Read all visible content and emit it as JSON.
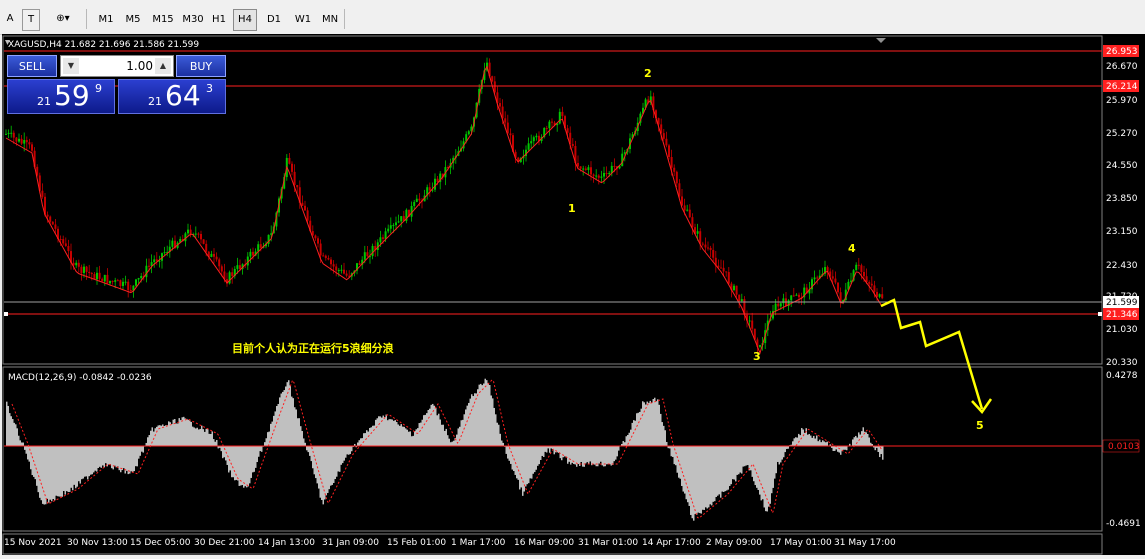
{
  "toolbar": {
    "tools": [
      {
        "name": "text-label-tool",
        "glyph": "A"
      },
      {
        "name": "text-tool",
        "glyph": "T"
      },
      {
        "name": "objects-tool",
        "glyph": "⊕▾"
      }
    ],
    "timeframes": [
      "M1",
      "M5",
      "M15",
      "M30",
      "H1",
      "H4",
      "D1",
      "W1",
      "MN"
    ],
    "active_timeframe": "H4"
  },
  "chart": {
    "header": "XAGUSD,H4  21.682 21.696 21.586 21.599",
    "macd_label": "MACD(12,26,9) -0.0842 -0.0236",
    "annotation_text": "目前个人认为正在运行5浪细分浪",
    "wave_labels": [
      "1",
      "2",
      "3",
      "4",
      "5"
    ],
    "colors": {
      "bull": "#00c800",
      "bear": "#c80000",
      "ma": "#ff2020",
      "arrow": "#ffff00",
      "line": "#ff2020",
      "histogram": "#c0c0c0",
      "axis_text": "#ffffff"
    }
  },
  "price_axis": {
    "ticks": [
      "26.670",
      "25.970",
      "25.270",
      "24.550",
      "23.850",
      "23.150",
      "22.430",
      "21.720",
      "21.030",
      "20.330"
    ],
    "highlight_top": "26.953",
    "highlight_mid": "26.214",
    "current_price": "21.599",
    "highlight_low": "21.346"
  },
  "macd_axis": {
    "top": "0.4278",
    "zero": "0.0103",
    "bottom": "-0.4691"
  },
  "time_axis": [
    "15 Nov 2021",
    "30 Nov 13:00",
    "15 Dec 05:00",
    "30 Dec 21:00",
    "14 Jan 13:00",
    "31 Jan 09:00",
    "15 Feb 01:00",
    "1 Mar 17:00",
    "16 Mar 09:00",
    "31 Mar 01:00",
    "14 Apr 17:00",
    "2 May 09:00",
    "17 May 01:00",
    "31 May 17:00"
  ],
  "trade_panel": {
    "sell_label": "SELL",
    "buy_label": "BUY",
    "lot_value": "1.00",
    "sell_price": {
      "prefix": "21",
      "big": "59",
      "sup": "9"
    },
    "buy_price": {
      "prefix": "21",
      "big": "64",
      "sup": "3"
    }
  }
}
